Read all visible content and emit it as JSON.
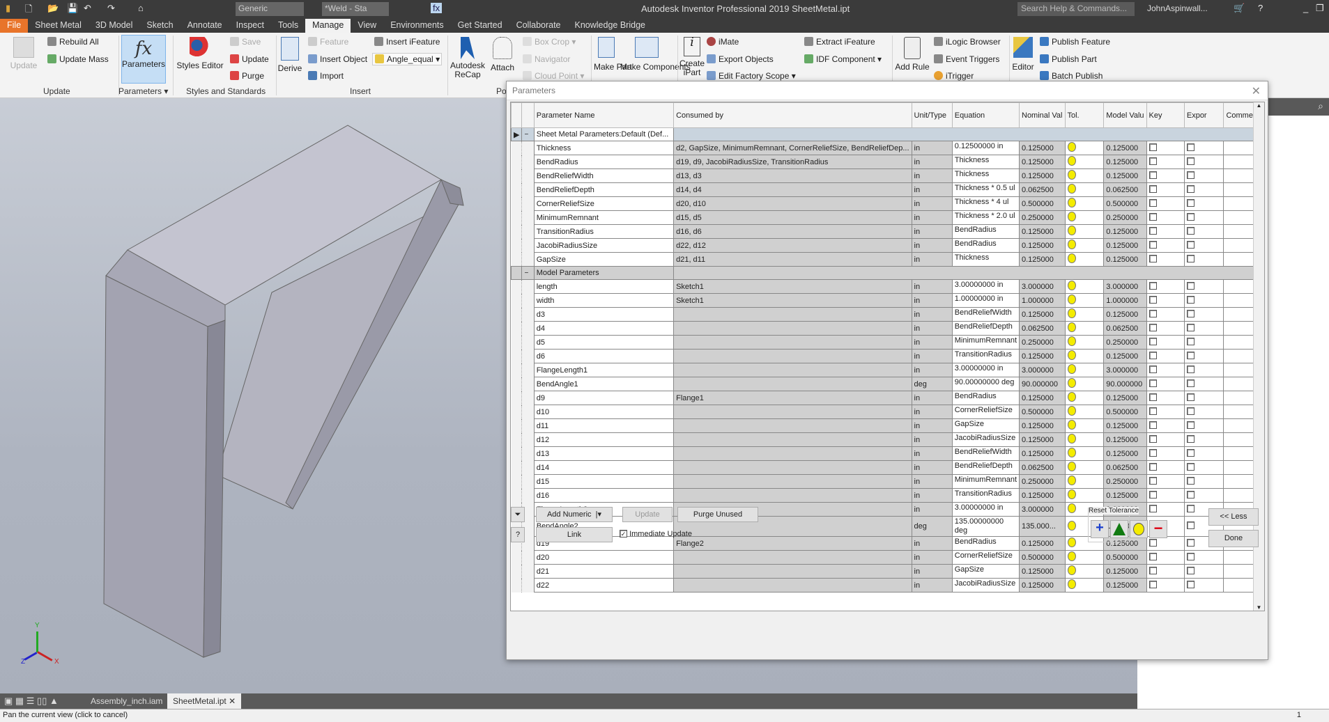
{
  "app": {
    "title": "Autodesk Inventor Professional 2019   SheetMetal.ipt",
    "search_placeholder": "Search Help & Commands...",
    "user": "JohnAspinwall...",
    "style_combo": "Generic",
    "material_combo": "*Weld - Sta"
  },
  "tabs": [
    "File",
    "Sheet Metal",
    "3D Model",
    "Sketch",
    "Annotate",
    "Inspect",
    "Tools",
    "Manage",
    "View",
    "Environments",
    "Get Started",
    "Collaborate",
    "Knowledge Bridge"
  ],
  "active_tab": "Manage",
  "ribbon": {
    "update": {
      "update": "Update",
      "rebuild_all": "Rebuild All",
      "update_mass": "Update Mass",
      "label": "Update"
    },
    "parameters": {
      "parameters": "Parameters",
      "label": "Parameters ▾"
    },
    "styles": {
      "styles_editor": "Styles Editor",
      "save": "Save",
      "update": "Update",
      "purge": "Purge",
      "label": "Styles and Standards"
    },
    "insert": {
      "derive": "Derive",
      "feature": "Feature",
      "insert_object": "Insert Object",
      "import": "Import",
      "insert_ifeature": "Insert iFeature",
      "angle_combo": "Angle_equal",
      "label": "Insert"
    },
    "point_cloud": {
      "recap": "Autodesk ReCap",
      "attach": "Attach",
      "box_crop": "Box Crop ▾",
      "navigator": "Navigator",
      "cloud_point": "Cloud Point ▾",
      "label": "Po"
    },
    "layout": {
      "make_part": "Make Part",
      "make_components": "Make Components"
    },
    "author": {
      "create_ipart": "Create iPart",
      "imate": "iMate",
      "export_objects": "Export Objects",
      "edit_factory_scope": "Edit Factory Scope ▾",
      "extract_ifeature": "Extract iFeature",
      "idf_component": "IDF Component ▾"
    },
    "ilogic": {
      "add_rule": "Add Rule",
      "ilogic_browser": "iLogic Browser",
      "event_triggers": "Event Triggers",
      "itrigger": "iTrigger"
    },
    "content": {
      "editor": "Editor",
      "publish_feature": "Publish Feature",
      "publish_part": "Publish Part",
      "batch_publish": "Batch Publish"
    }
  },
  "dialog": {
    "title": "Parameters",
    "columns": [
      "Parameter Name",
      "Consumed by",
      "Unit/Type",
      "Equation",
      "Nominal Val",
      "Tol.",
      "Model Valu",
      "Key",
      "Expor",
      "Comment"
    ],
    "groups": [
      {
        "name": "Sheet Metal Parameters:Default (Def...",
        "rows": [
          [
            "Thickness",
            "d2, GapSize, MinimumRemnant, CornerReliefSize, BendReliefDep...",
            "in",
            "0.12500000 in",
            "0.125000",
            "0.125000"
          ],
          [
            "BendRadius",
            "d19, d9, JacobiRadiusSize, TransitionRadius",
            "in",
            "Thickness",
            "0.125000",
            "0.125000"
          ],
          [
            "BendReliefWidth",
            "d13, d3",
            "in",
            "Thickness",
            "0.125000",
            "0.125000"
          ],
          [
            "BendReliefDepth",
            "d14, d4",
            "in",
            "Thickness * 0.5 ul",
            "0.062500",
            "0.062500"
          ],
          [
            "CornerReliefSize",
            "d20, d10",
            "in",
            "Thickness * 4 ul",
            "0.500000",
            "0.500000"
          ],
          [
            "MinimumRemnant",
            "d15, d5",
            "in",
            "Thickness * 2.0 ul",
            "0.250000",
            "0.250000"
          ],
          [
            "TransitionRadius",
            "d16, d6",
            "in",
            "BendRadius",
            "0.125000",
            "0.125000"
          ],
          [
            "JacobiRadiusSize",
            "d22, d12",
            "in",
            "BendRadius",
            "0.125000",
            "0.125000"
          ],
          [
            "GapSize",
            "d21, d11",
            "in",
            "Thickness",
            "0.125000",
            "0.125000"
          ]
        ]
      },
      {
        "name": "Model Parameters",
        "rows": [
          [
            "length",
            "Sketch1",
            "in",
            "3.00000000 in",
            "3.000000",
            "3.000000"
          ],
          [
            "width",
            "Sketch1",
            "in",
            "1.00000000 in",
            "1.000000",
            "1.000000"
          ],
          [
            "d3",
            "",
            "in",
            "BendReliefWidth",
            "0.125000",
            "0.125000"
          ],
          [
            "d4",
            "",
            "in",
            "BendReliefDepth",
            "0.062500",
            "0.062500"
          ],
          [
            "d5",
            "",
            "in",
            "MinimumRemnant",
            "0.250000",
            "0.250000"
          ],
          [
            "d6",
            "",
            "in",
            "TransitionRadius",
            "0.125000",
            "0.125000"
          ],
          [
            "FlangeLength1",
            "",
            "in",
            "3.00000000 in",
            "3.000000",
            "3.000000"
          ],
          [
            "BendAngle1",
            "",
            "deg",
            "90.00000000 deg",
            "90.000000",
            "90.000000"
          ],
          [
            "d9",
            "Flange1",
            "in",
            "BendRadius",
            "0.125000",
            "0.125000"
          ],
          [
            "d10",
            "",
            "in",
            "CornerReliefSize",
            "0.500000",
            "0.500000"
          ],
          [
            "d11",
            "",
            "in",
            "GapSize",
            "0.125000",
            "0.125000"
          ],
          [
            "d12",
            "",
            "in",
            "JacobiRadiusSize",
            "0.125000",
            "0.125000"
          ],
          [
            "d13",
            "",
            "in",
            "BendReliefWidth",
            "0.125000",
            "0.125000"
          ],
          [
            "d14",
            "",
            "in",
            "BendReliefDepth",
            "0.062500",
            "0.062500"
          ],
          [
            "d15",
            "",
            "in",
            "MinimumRemnant",
            "0.250000",
            "0.250000"
          ],
          [
            "d16",
            "",
            "in",
            "TransitionRadius",
            "0.125000",
            "0.125000"
          ],
          [
            "FlangeLength2",
            "",
            "in",
            "3.00000000 in",
            "3.000000",
            "3.000000"
          ],
          [
            "BendAngle2",
            "",
            "deg",
            "135.00000000 deg",
            "135.000...",
            "135.000..."
          ],
          [
            "d19",
            "Flange2",
            "in",
            "BendRadius",
            "0.125000",
            "0.125000"
          ],
          [
            "d20",
            "",
            "in",
            "CornerReliefSize",
            "0.500000",
            "0.500000"
          ],
          [
            "d21",
            "",
            "in",
            "GapSize",
            "0.125000",
            "0.125000"
          ],
          [
            "d22",
            "",
            "in",
            "JacobiRadiusSize",
            "0.125000",
            "0.125000"
          ]
        ]
      }
    ],
    "tolerance_color": "#f4ec00",
    "buttons": {
      "add_numeric": "Add Numeric",
      "update": "Update",
      "purge_unused": "Purge Unused",
      "link": "Link",
      "immediate_update": "Immediate Update",
      "immediate_update_checked": true,
      "less": "<< Less",
      "done": "Done",
      "reset_tolerance": "Reset Tolerance"
    }
  },
  "doc_tabs": [
    "Assembly_inch.iam",
    "SheetMetal.ipt"
  ],
  "status": {
    "text": "Pan the current view (click to cancel)",
    "right": "1"
  },
  "triad": {
    "x": "X",
    "y": "Y",
    "z": "Z"
  }
}
